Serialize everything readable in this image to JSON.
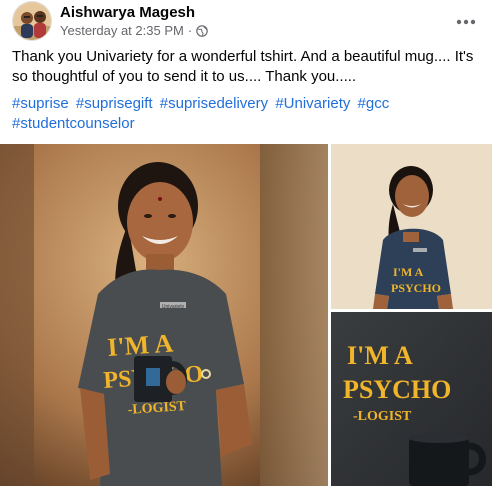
{
  "post": {
    "author": "Aishwarya Magesh",
    "timestamp": "Yesterday at 2:35 PM",
    "separator": "·",
    "privacy_icon": "globe-icon",
    "more_icon": "more-horizontal-icon",
    "text": "Thank you Univariety for a wonderful tshirt. And a beautiful mug....  It's so thoughtful of you to send it to us.... Thank you.....",
    "hashtags": [
      "#suprise",
      "#suprisegift",
      "#suprisedelivery",
      "#Univariety",
      "#gcc",
      "#studentcounselor"
    ]
  },
  "photos": {
    "shirt_print_line1": "I'M A",
    "shirt_print_line2": "PSYCHO",
    "shirt_print_line3": "-LOGIST",
    "shirt_logo": "Univariety"
  },
  "colors": {
    "link": "#216fdb",
    "secondary_text": "#65676b",
    "shirt_gray": "#4a4d50",
    "print_yellow": "#f0b52a"
  }
}
